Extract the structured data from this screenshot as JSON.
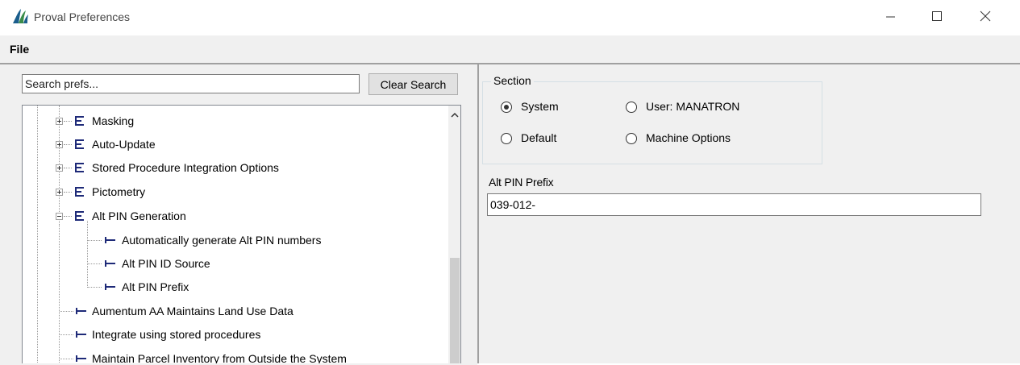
{
  "window": {
    "title": "Proval Preferences",
    "app_icon": "proval-logo-icon",
    "controls": [
      "minimize-icon",
      "maximize-icon",
      "close-icon"
    ]
  },
  "menu": {
    "items": [
      "File"
    ]
  },
  "search": {
    "placeholder": "Search prefs...",
    "value": "",
    "clear_label": "Clear Search"
  },
  "tree": {
    "nodes": [
      {
        "label": "Masking",
        "type": "group",
        "expanded": false
      },
      {
        "label": "Auto-Update",
        "type": "group",
        "expanded": false
      },
      {
        "label": "Stored Procedure Integration Options",
        "type": "group",
        "expanded": false
      },
      {
        "label": "Pictometry",
        "type": "group",
        "expanded": false
      },
      {
        "label": "Alt PIN Generation",
        "type": "group",
        "expanded": true
      },
      {
        "label": "Automatically generate Alt PIN numbers",
        "type": "leaf",
        "level": 2
      },
      {
        "label": "Alt PIN ID Source",
        "type": "leaf",
        "level": 2
      },
      {
        "label": "Alt PIN Prefix",
        "type": "leaf",
        "level": 2
      },
      {
        "label": "Aumentum AA Maintains Land Use Data",
        "type": "leaf",
        "level": 1
      },
      {
        "label": "Integrate using stored procedures",
        "type": "leaf",
        "level": 1
      },
      {
        "label": "Maintain Parcel Inventory from Outside the System",
        "type": "leaf",
        "level": 1
      }
    ]
  },
  "section": {
    "legend": "Section",
    "options": [
      {
        "label": "System",
        "checked": true
      },
      {
        "label": "User: MANATRON",
        "checked": false
      },
      {
        "label": "Default",
        "checked": false
      },
      {
        "label": "Machine Options",
        "checked": false
      }
    ]
  },
  "field": {
    "label": "Alt PIN Prefix",
    "value": "039-012-"
  },
  "colors": {
    "panel": "#f0f0f0",
    "tree_icon": "#1e2a78",
    "logo": "#1b5e8c"
  }
}
